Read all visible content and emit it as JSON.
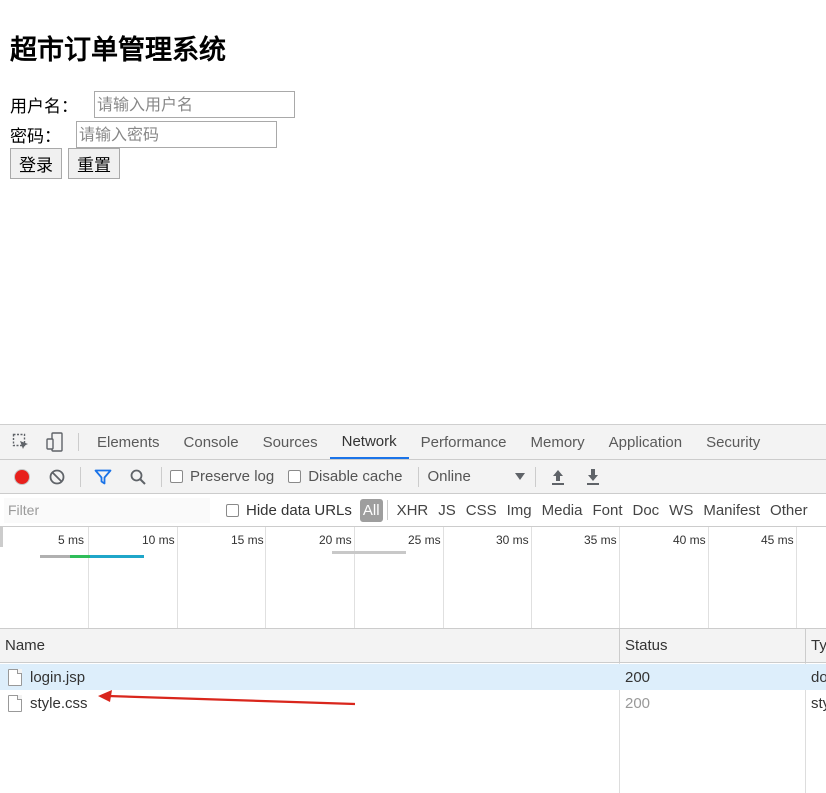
{
  "page": {
    "title": "超市订单管理系统",
    "username_label": "用户名：",
    "username_placeholder": "请输入用户名",
    "password_label": "密码：",
    "password_placeholder": "请输入密码",
    "login_button": "登录",
    "reset_button": "重置"
  },
  "devtools": {
    "tabs": [
      "Elements",
      "Console",
      "Sources",
      "Network",
      "Performance",
      "Memory",
      "Application",
      "Security"
    ],
    "active_tab": "Network",
    "toolbar": {
      "preserve_log": "Preserve log",
      "disable_cache": "Disable cache",
      "throttling": "Online"
    },
    "filter": {
      "placeholder": "Filter",
      "hide_data_urls": "Hide data URLs",
      "types": [
        "All",
        "XHR",
        "JS",
        "CSS",
        "Img",
        "Media",
        "Font",
        "Doc",
        "WS",
        "Manifest",
        "Other"
      ],
      "active_type": "All"
    },
    "timeline_ticks": [
      "5 ms",
      "10 ms",
      "15 ms",
      "20 ms",
      "25 ms",
      "30 ms",
      "35 ms",
      "40 ms",
      "45 ms"
    ],
    "columns": {
      "name": "Name",
      "status": "Status",
      "type": "Ty"
    },
    "requests": [
      {
        "name": "login.jsp",
        "status": "200",
        "type": "do",
        "selected": true
      },
      {
        "name": "style.css",
        "status": "200",
        "type": "sty",
        "selected": false
      }
    ],
    "colors": {
      "record": "#e8201c",
      "accent": "#1a73e8",
      "annotation_arrow": "#d9261c"
    }
  }
}
